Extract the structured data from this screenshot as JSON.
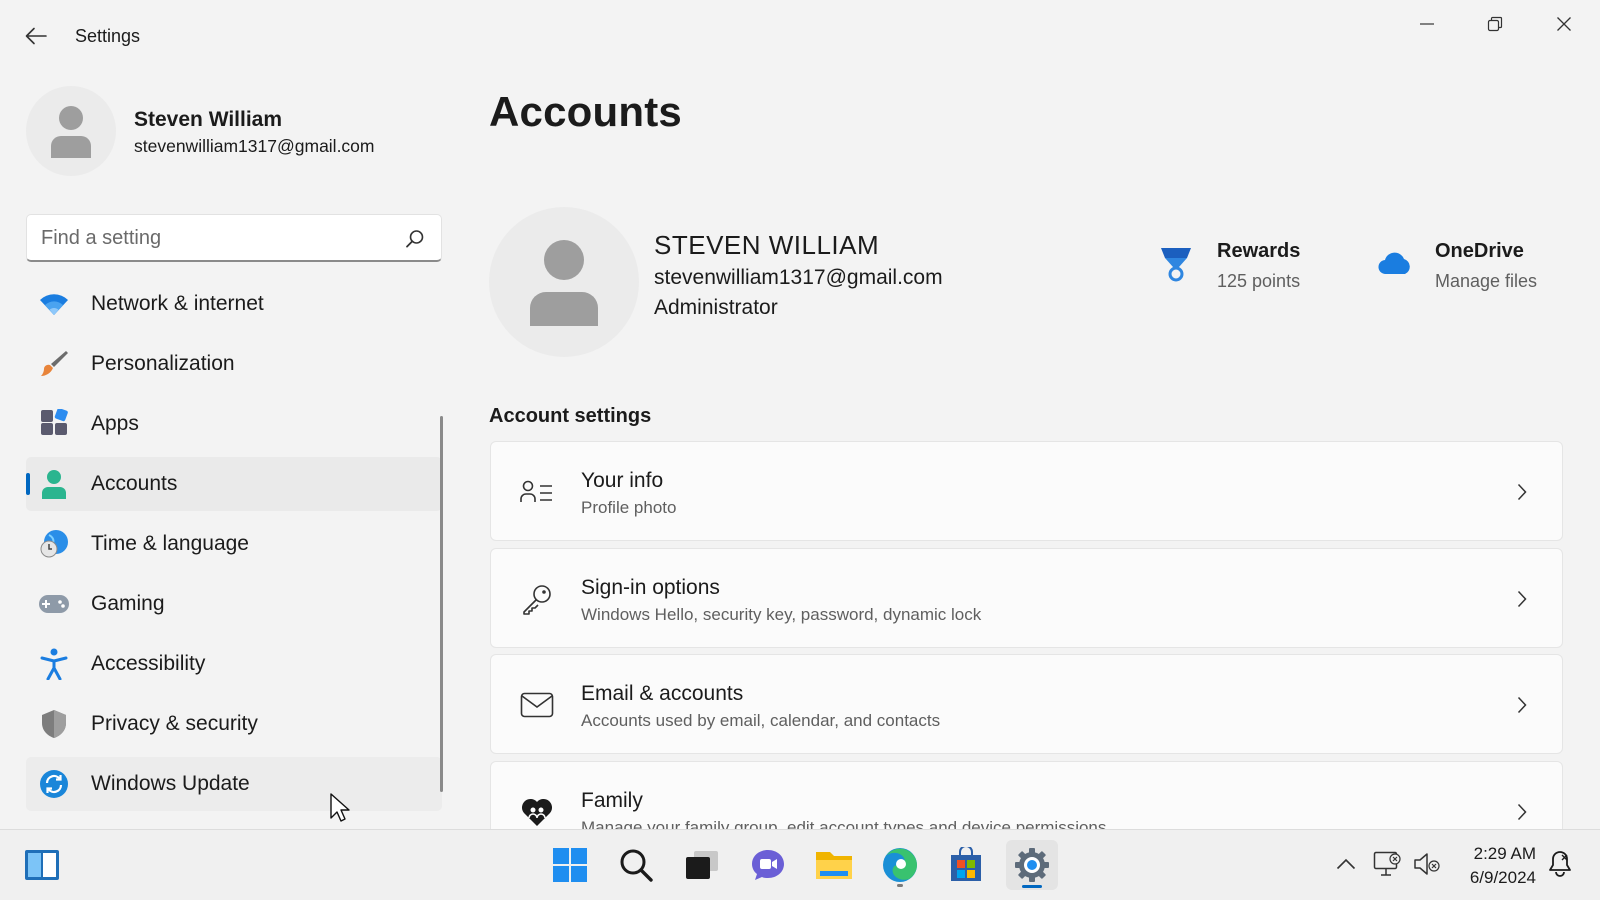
{
  "window": {
    "title": "Settings"
  },
  "profile": {
    "name": "Steven William",
    "email": "stevenwilliam1317@gmail.com"
  },
  "search": {
    "placeholder": "Find a setting"
  },
  "nav": {
    "items": [
      {
        "label": "Network & internet",
        "icon": "wifi-icon"
      },
      {
        "label": "Personalization",
        "icon": "brush-icon"
      },
      {
        "label": "Apps",
        "icon": "apps-icon"
      },
      {
        "label": "Accounts",
        "icon": "accounts-icon",
        "selected": true
      },
      {
        "label": "Time & language",
        "icon": "globe-clock-icon"
      },
      {
        "label": "Gaming",
        "icon": "gamepad-icon"
      },
      {
        "label": "Accessibility",
        "icon": "accessibility-icon"
      },
      {
        "label": "Privacy & security",
        "icon": "shield-icon"
      },
      {
        "label": "Windows Update",
        "icon": "update-icon",
        "hovered": true
      }
    ]
  },
  "main": {
    "title": "Accounts",
    "account": {
      "name": "STEVEN WILLIAM",
      "email": "stevenwilliam1317@gmail.com",
      "role": "Administrator"
    },
    "rewards": {
      "title": "Rewards",
      "subtitle": "125 points"
    },
    "onedrive": {
      "title": "OneDrive",
      "subtitle": "Manage files"
    },
    "section_title": "Account settings",
    "cards": [
      {
        "title": "Your info",
        "subtitle": "Profile photo",
        "icon": "person-list-icon"
      },
      {
        "title": "Sign-in options",
        "subtitle": "Windows Hello, security key, password, dynamic lock",
        "icon": "key-icon"
      },
      {
        "title": "Email & accounts",
        "subtitle": "Accounts used by email, calendar, and contacts",
        "icon": "mail-icon"
      },
      {
        "title": "Family",
        "subtitle": "Manage your family group, edit account types and device permissions",
        "icon": "family-heart-icon"
      }
    ]
  },
  "taskbar": {
    "apps": [
      "widgets-icon",
      "start-icon",
      "search-icon",
      "task-view-icon",
      "chat-icon",
      "file-explorer-icon",
      "edge-icon",
      "store-icon",
      "settings-icon"
    ],
    "clock": {
      "time": "2:29 AM",
      "date": "6/9/2024"
    }
  },
  "colors": {
    "accent": "#0067c0",
    "background": "#f3f3f3"
  }
}
